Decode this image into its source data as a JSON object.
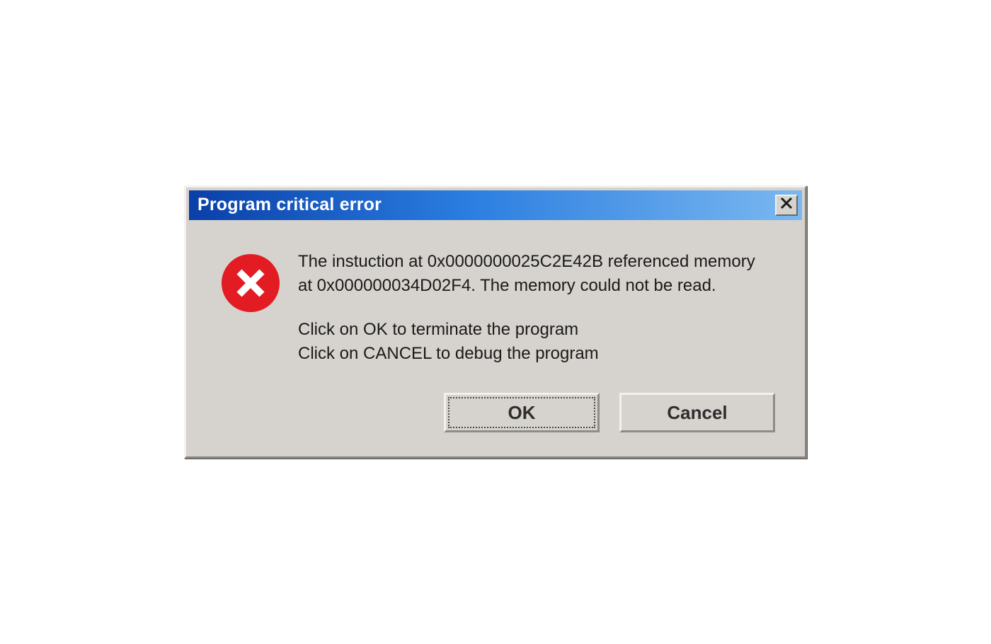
{
  "dialog": {
    "title": "Program critical error",
    "message_main": "The instuction at 0x0000000025C2E42B referenced memory at 0x000000034D02F4. The memory could not be read.",
    "message_actions": "Click on OK to terminate the program\nClick on CANCEL to debug the program",
    "buttons": {
      "ok": "OK",
      "cancel": "Cancel"
    }
  }
}
